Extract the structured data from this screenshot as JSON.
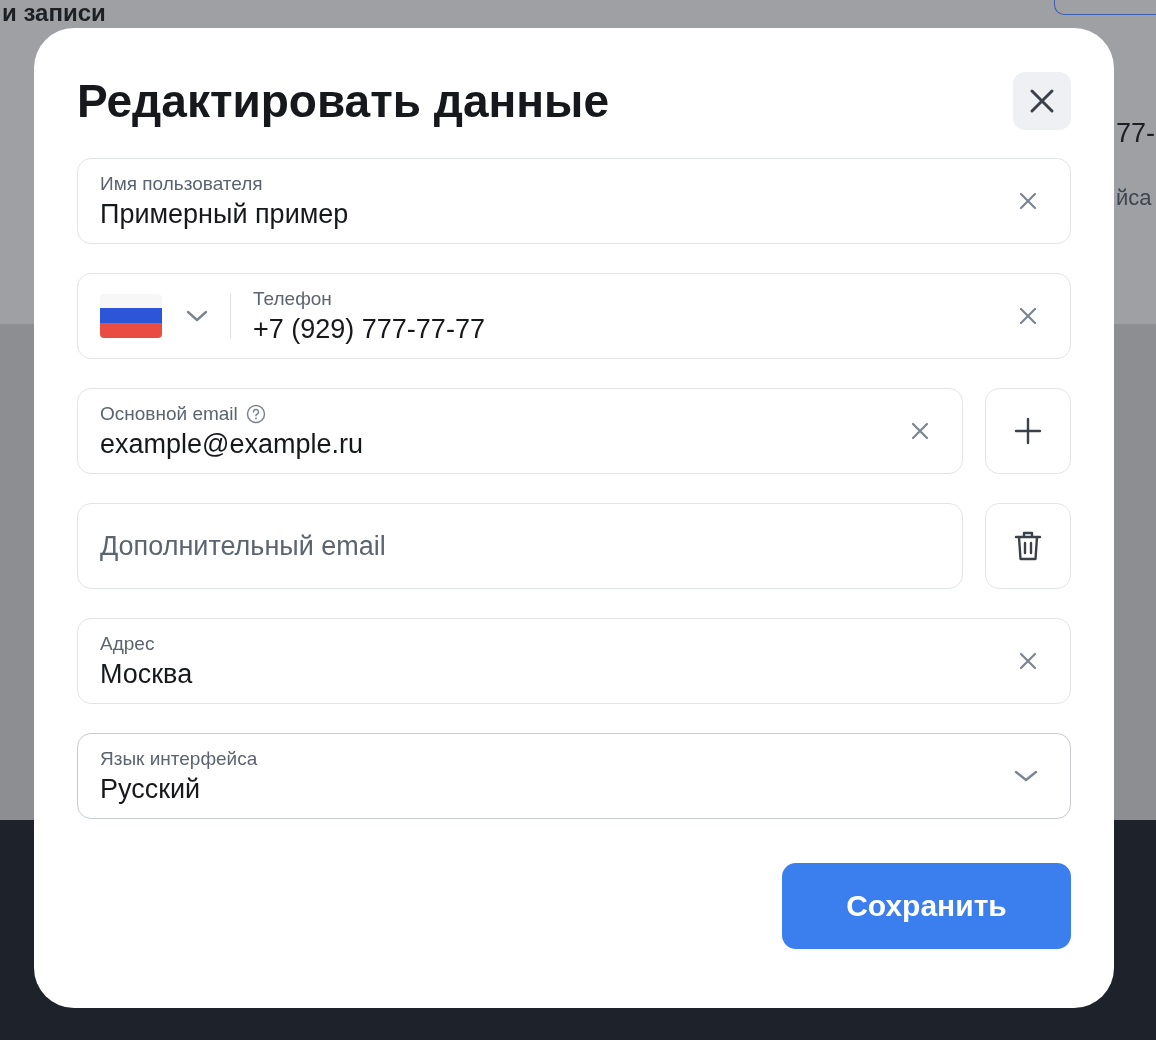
{
  "background": {
    "heading": "и записи",
    "fragments": [
      "77-",
      "йса"
    ]
  },
  "dialog": {
    "title": "Редактировать данные",
    "fields": [
      {
        "kind": "text",
        "label": "Имя пользователя",
        "value": "Примерный пример",
        "clearable": true
      },
      {
        "kind": "phone",
        "label": "Телефон",
        "value": "+7 (929) 777-77-77",
        "clearable": true
      },
      {
        "kind": "text",
        "label": "Основной email",
        "help": true,
        "value": "example@example.ru",
        "clearable": true,
        "action": {
          "kind": "add"
        }
      },
      {
        "kind": "text",
        "placeholder": "Дополнительный email",
        "action": {
          "kind": "delete"
        }
      },
      {
        "kind": "text",
        "label": "Адрес",
        "value": "Москва",
        "clearable": true
      },
      {
        "kind": "select",
        "label": "Язык интерфейса",
        "value": "Русский"
      }
    ],
    "save_button": "Сохранить"
  }
}
